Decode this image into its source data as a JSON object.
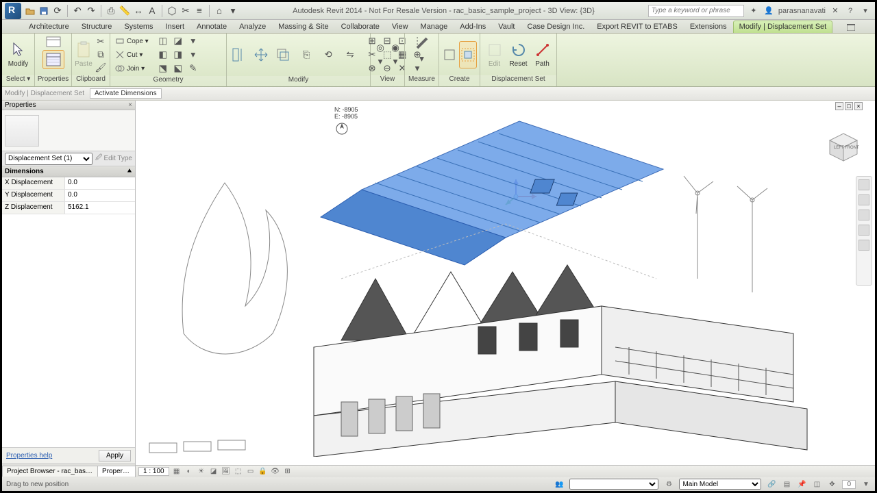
{
  "app": {
    "title": "Autodesk Revit 2014 - Not For Resale Version - rac_basic_sample_project - 3D View: {3D}",
    "search_placeholder": "Type a keyword or phrase",
    "user": "parasnanavati"
  },
  "ribbon_tabs": [
    "Architecture",
    "Structure",
    "Systems",
    "Insert",
    "Annotate",
    "Analyze",
    "Massing & Site",
    "Collaborate",
    "View",
    "Manage",
    "Add-Ins",
    "Vault",
    "Case Design Inc.",
    "Export REVIT to ETABS",
    "Extensions",
    "Modify | Displacement Set"
  ],
  "ribbon_active": 15,
  "panels": {
    "select": "Select ▾",
    "properties": "Properties",
    "clipboard": "Clipboard",
    "geometry": "Geometry",
    "modify_label": "Modify",
    "view": "View",
    "measure": "Measure",
    "create": "Create",
    "displacement": "Displacement Set"
  },
  "big_buttons": {
    "modify": "Modify",
    "paste": "Paste",
    "edit": "Edit",
    "reset": "Reset",
    "path": "Path"
  },
  "geom_btns": {
    "cope": "Cope ▾",
    "cut": "Cut ▾",
    "join": "Join ▾"
  },
  "optionbar": {
    "context": "Modify | Displacement Set",
    "cmd": "Activate Dimensions"
  },
  "properties": {
    "title": "Properties",
    "selector": "Displacement Set (1)",
    "edit_type": "Edit Type",
    "group": "Dimensions",
    "rows": [
      {
        "k": "X Displacement",
        "v": "0.0"
      },
      {
        "k": "Y Displacement",
        "v": "0.0"
      },
      {
        "k": "Z Displacement",
        "v": "5162.1"
      }
    ],
    "help": "Properties help",
    "apply": "Apply"
  },
  "viewport": {
    "coord1": "N: -8905",
    "coord2": "E: -8905"
  },
  "viewbar": {
    "scale": "1 : 100"
  },
  "bottom_tabs": [
    "Project Browser - rac_basic_samp...",
    "Properties"
  ],
  "status": {
    "msg": "Drag to new position",
    "workset": "Main Model",
    "press": "0"
  }
}
